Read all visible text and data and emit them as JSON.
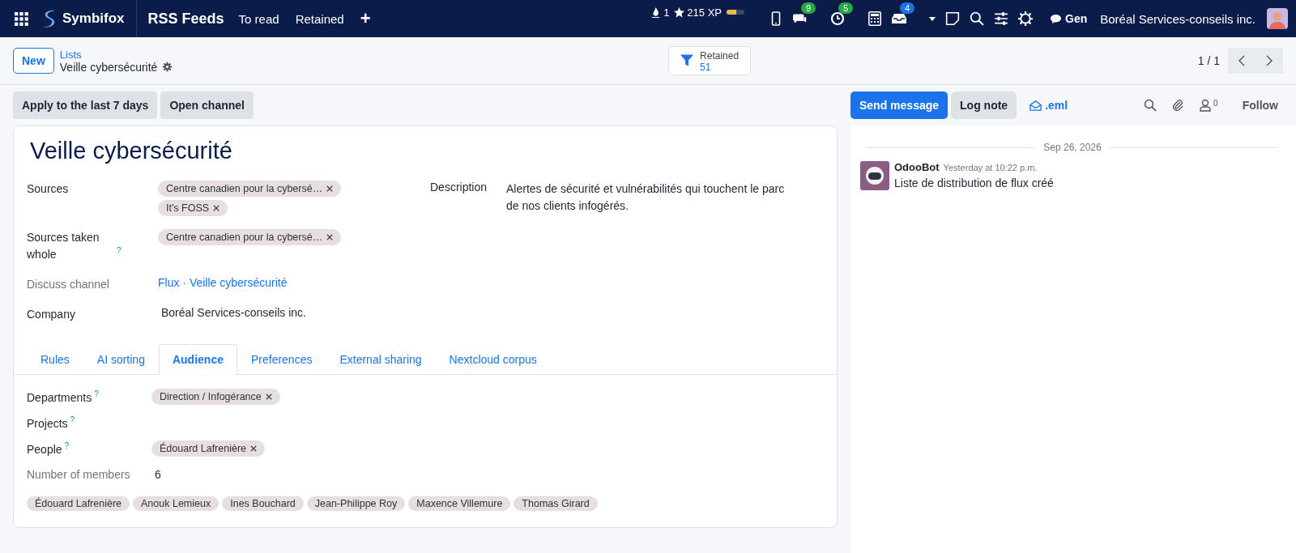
{
  "navbar": {
    "brand": "Symbifox",
    "app_name": "RSS Feeds",
    "menu": [
      "To read",
      "Retained"
    ],
    "add": "+",
    "streak": "1",
    "xp": "215 XP",
    "xp_bar": {
      "level": 0.55
    },
    "systray": [
      {
        "kind": "phone"
      },
      {
        "kind": "chat",
        "badge": "9",
        "color": "#28a745"
      },
      {
        "kind": "clock",
        "badge": "5",
        "color": "#28a745"
      },
      {
        "kind": "calculator"
      },
      {
        "kind": "inbox",
        "badge": "4",
        "color": "#1a73e8"
      },
      {
        "kind": "caret"
      },
      {
        "kind": "note"
      },
      {
        "kind": "search"
      },
      {
        "kind": "sliders"
      },
      {
        "kind": "gear"
      }
    ],
    "chat_label": "Gen",
    "company": "Boréal Services-conseils inc."
  },
  "control_panel": {
    "new": "New",
    "breadcrumb": "Lists",
    "current": "Veille cybersécurité",
    "filter": {
      "label": "Retained",
      "count": "51"
    },
    "pager": "1 / 1"
  },
  "actions": [
    "Apply to the last 7 days",
    "Open channel"
  ],
  "form": {
    "title": "Veille cybersécurité",
    "fields": [
      {
        "label": "Sources",
        "muted": false,
        "kind": "tags",
        "tags": [
          "Centre canadien pour la cybersé…",
          "It's FOSS"
        ]
      },
      {
        "label": "Sources taken whole",
        "muted": false,
        "help": "?",
        "kind": "tags",
        "tags": [
          "Centre canadien pour la cybersé…"
        ]
      },
      {
        "label": "Discuss channel",
        "muted": true,
        "kind": "link",
        "value": "Flux · Veille cybersécurité"
      },
      {
        "label": "Company",
        "muted": false,
        "kind": "text",
        "value": "Boréal Services-conseils inc."
      }
    ],
    "description": {
      "label": "Description",
      "value": "Alertes de sécurité et vulnérabilités qui touchent le parc de nos clients infogérés."
    },
    "tabs": [
      {
        "label": "Rules",
        "selected": false
      },
      {
        "label": "AI sorting",
        "selected": false
      },
      {
        "label": "Audience",
        "selected": true
      },
      {
        "label": "Preferences",
        "selected": false
      },
      {
        "label": "External sharing",
        "selected": false
      },
      {
        "label": "Nextcloud corpus",
        "selected": false
      }
    ],
    "audience": [
      {
        "label": "Departments",
        "muted": false,
        "help": "?",
        "kind": "tags",
        "tags": [
          "Direction / Infogérance"
        ]
      },
      {
        "label": "Projects",
        "muted": false,
        "help": "?",
        "kind": "tags"
      },
      {
        "label": "People",
        "muted": false,
        "help": "?",
        "kind": "tags",
        "tags": [
          "Édouard Lafrenière"
        ]
      },
      {
        "label": "Number of members",
        "muted": true,
        "kind": "text",
        "value": "6"
      }
    ],
    "members": [
      "Édouard Lafrenière",
      "Anouk Lemieux",
      "Ines Bouchard",
      "Jean-Philippe Roy",
      "Maxence Villemure",
      "Thomas Girard"
    ]
  },
  "chatter": {
    "send": "Send message",
    "log": "Log note",
    "eml": ".eml",
    "followers": "0",
    "follow": "Follow",
    "date": "Sep 26, 2026",
    "messages": [
      {
        "author": "OdooBot",
        "time": "Yesterday at 10:22 p.m.",
        "body": "Liste de distribution de flux créé"
      }
    ]
  }
}
